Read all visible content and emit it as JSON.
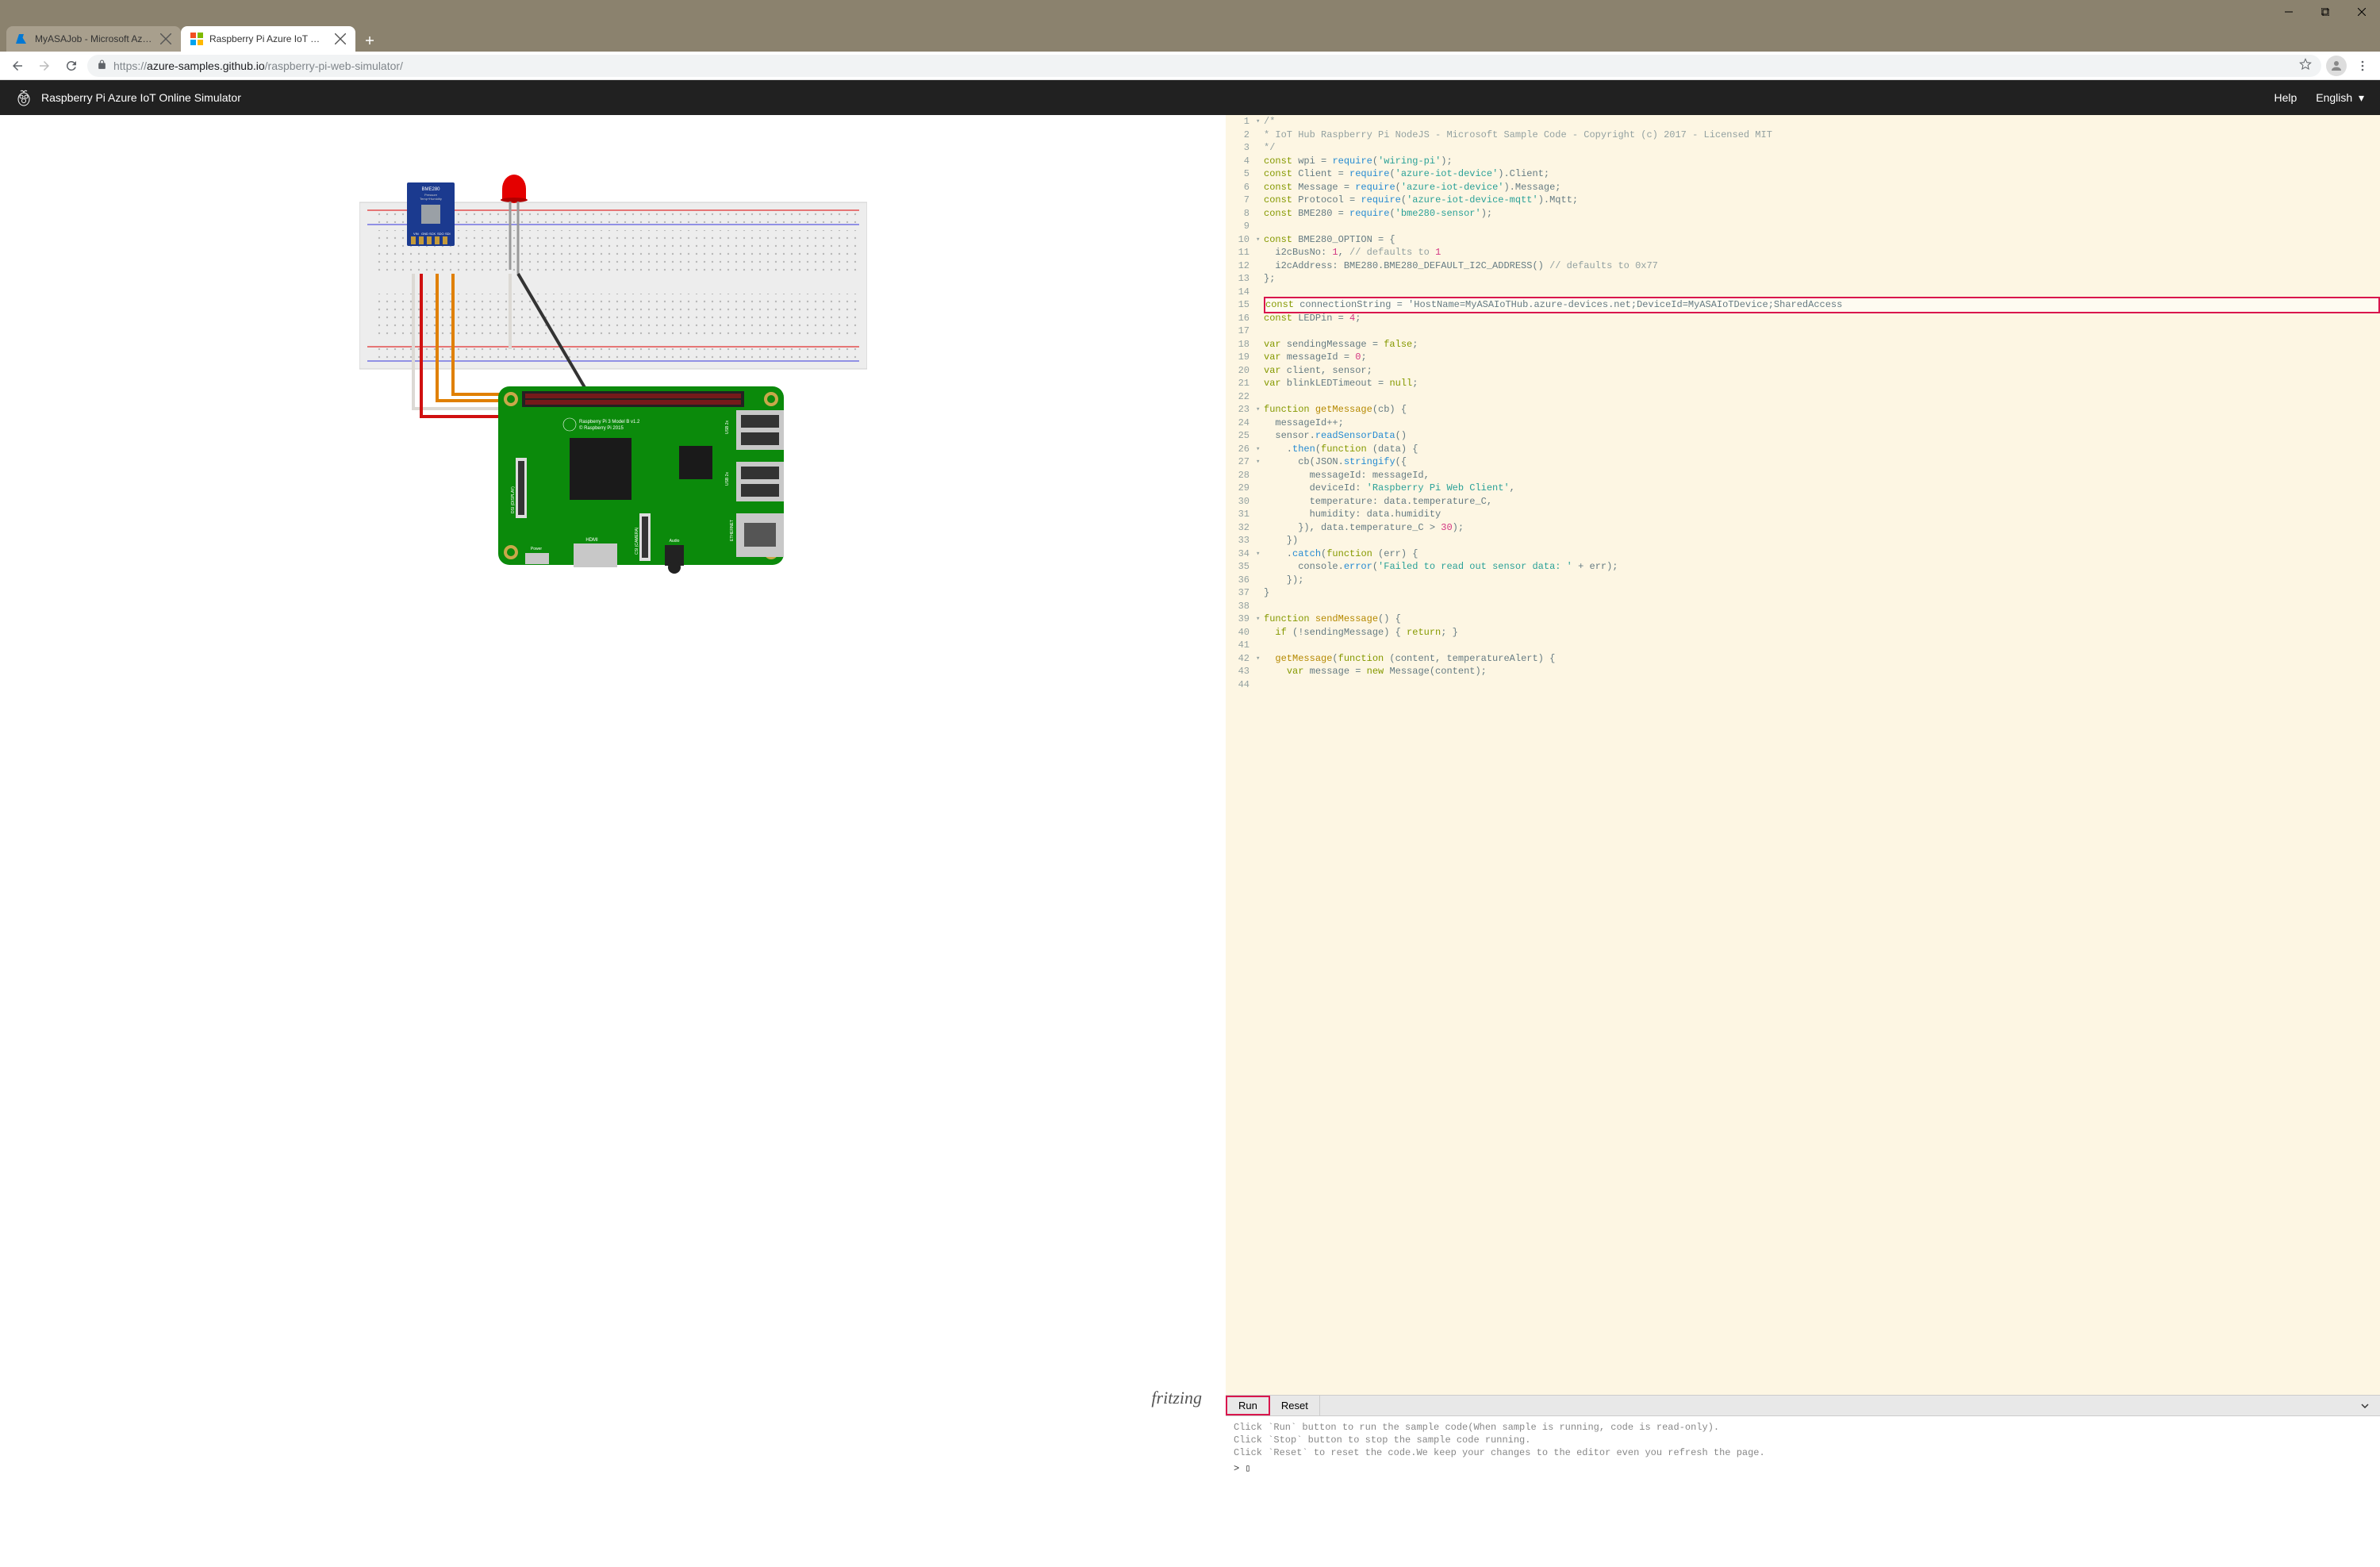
{
  "browser": {
    "tabs": [
      {
        "title": "MyASAJob - Microsoft Azure",
        "active": false
      },
      {
        "title": "Raspberry Pi Azure IoT Web Simul",
        "active": true
      }
    ],
    "url_host": "azure-samples.github.io",
    "url_path": "/raspberry-pi-web-simulator/",
    "url_scheme": "https://"
  },
  "header": {
    "title": "Raspberry Pi Azure IoT Online Simulator",
    "help": "Help",
    "language": "English"
  },
  "diagram": {
    "rpi_label1": "Raspberry Pi 3 Model B v1.2",
    "rpi_label2": "© Raspberry Pi 2015",
    "credit": "fritzing",
    "sensor": "BME280",
    "sensor_sub1": "Pressure",
    "sensor_sub2": "Temp+Humidity"
  },
  "code": {
    "lines": [
      {
        "n": 1,
        "f": "▾",
        "cls": "c-comment",
        "t": "/*"
      },
      {
        "n": 2,
        "cls": "c-comment",
        "t": "* IoT Hub Raspberry Pi NodeJS - Microsoft Sample Code - Copyright (c) 2017 - Licensed MIT"
      },
      {
        "n": 3,
        "cls": "c-comment",
        "t": "*/"
      },
      {
        "n": 4,
        "t": "const wpi = require('wiring-pi');"
      },
      {
        "n": 5,
        "t": "const Client = require('azure-iot-device').Client;"
      },
      {
        "n": 6,
        "t": "const Message = require('azure-iot-device').Message;"
      },
      {
        "n": 7,
        "t": "const Protocol = require('azure-iot-device-mqtt').Mqtt;"
      },
      {
        "n": 8,
        "t": "const BME280 = require('bme280-sensor');"
      },
      {
        "n": 9,
        "t": ""
      },
      {
        "n": 10,
        "f": "▾",
        "t": "const BME280_OPTION = {"
      },
      {
        "n": 11,
        "t": "  i2cBusNo: 1, // defaults to 1"
      },
      {
        "n": 12,
        "t": "  i2cAddress: BME280.BME280_DEFAULT_I2C_ADDRESS() // defaults to 0x77"
      },
      {
        "n": 13,
        "t": "};"
      },
      {
        "n": 14,
        "t": ""
      },
      {
        "n": 15,
        "hl": true,
        "t": "const connectionString = 'HostName=MyASAIoTHub.azure-devices.net;DeviceId=MyASAIoTDevice;SharedAccess"
      },
      {
        "n": 16,
        "t": "const LEDPin = 4;"
      },
      {
        "n": 17,
        "t": ""
      },
      {
        "n": 18,
        "t": "var sendingMessage = false;"
      },
      {
        "n": 19,
        "t": "var messageId = 0;"
      },
      {
        "n": 20,
        "t": "var client, sensor;"
      },
      {
        "n": 21,
        "t": "var blinkLEDTimeout = null;"
      },
      {
        "n": 22,
        "t": ""
      },
      {
        "n": 23,
        "f": "▾",
        "t": "function getMessage(cb) {"
      },
      {
        "n": 24,
        "t": "  messageId++;"
      },
      {
        "n": 25,
        "t": "  sensor.readSensorData()"
      },
      {
        "n": 26,
        "f": "▾",
        "t": "    .then(function (data) {"
      },
      {
        "n": 27,
        "f": "▾",
        "t": "      cb(JSON.stringify({"
      },
      {
        "n": 28,
        "t": "        messageId: messageId,"
      },
      {
        "n": 29,
        "t": "        deviceId: 'Raspberry Pi Web Client',"
      },
      {
        "n": 30,
        "t": "        temperature: data.temperature_C,"
      },
      {
        "n": 31,
        "t": "        humidity: data.humidity"
      },
      {
        "n": 32,
        "t": "      }), data.temperature_C > 30);"
      },
      {
        "n": 33,
        "t": "    })"
      },
      {
        "n": 34,
        "f": "▾",
        "t": "    .catch(function (err) {"
      },
      {
        "n": 35,
        "t": "      console.error('Failed to read out sensor data: ' + err);"
      },
      {
        "n": 36,
        "t": "    });"
      },
      {
        "n": 37,
        "t": "}"
      },
      {
        "n": 38,
        "t": ""
      },
      {
        "n": 39,
        "f": "▾",
        "t": "function sendMessage() {"
      },
      {
        "n": 40,
        "t": "  if (!sendingMessage) { return; }"
      },
      {
        "n": 41,
        "t": ""
      },
      {
        "n": 42,
        "f": "▾",
        "t": "  getMessage(function (content, temperatureAlert) {"
      },
      {
        "n": 43,
        "t": "    var message = new Message(content);"
      },
      {
        "n": 44,
        "t": ""
      }
    ]
  },
  "runbar": {
    "run": "Run",
    "reset": "Reset"
  },
  "console": {
    "l1": "Click `Run` button to run the sample code(When sample is running, code is read-only).",
    "l2": "Click `Stop` button to stop the sample code running.",
    "l3": "Click `Reset` to reset the code.We keep your changes to the editor even you refresh the page.",
    "prompt": "> ▯"
  }
}
